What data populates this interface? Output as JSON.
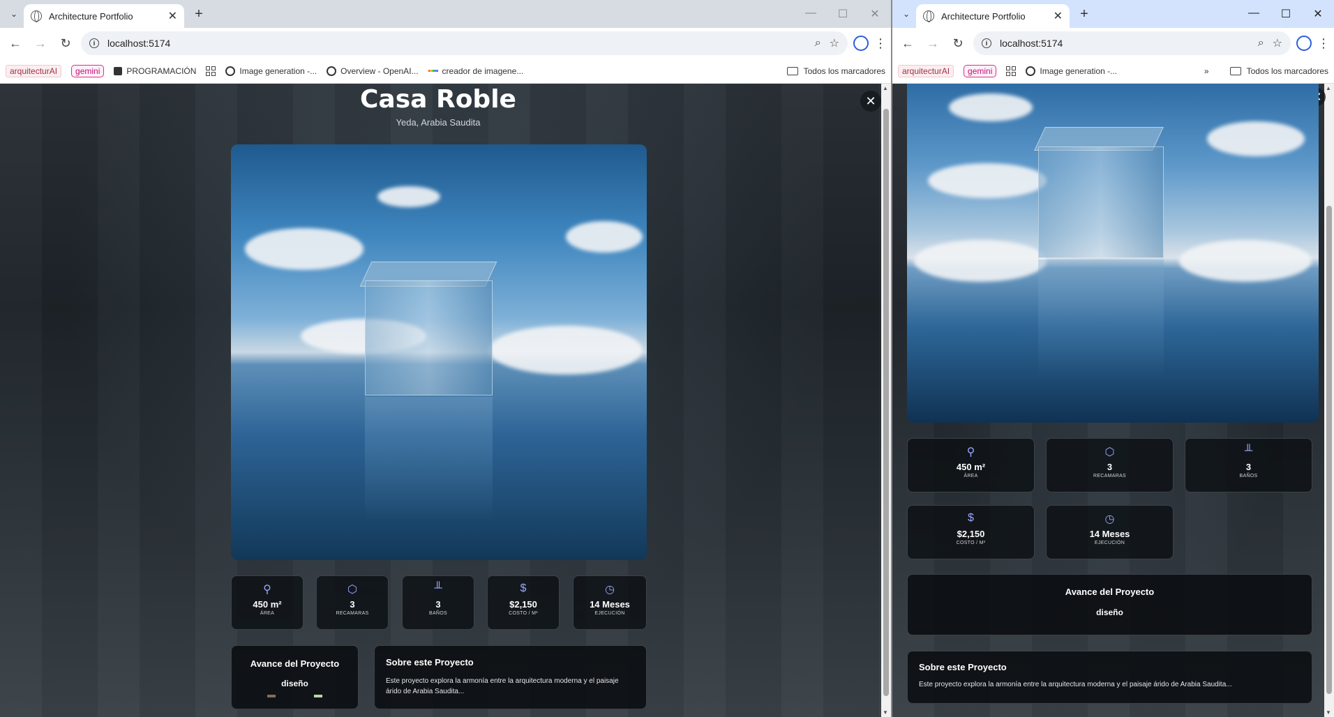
{
  "browser": {
    "tab_title": "Architecture Portfolio",
    "url": "localhost:5174",
    "bookmarks_left": [
      "arquitecturAI",
      "gemini",
      "PROGRAMACIÓN",
      "Image generation -...",
      "Overview - OpenAI...",
      "creador de imagene..."
    ],
    "bookmarks_right": [
      "arquitecturAI",
      "gemini",
      "Image generation -..."
    ],
    "all_bookmarks": "Todos los marcadores",
    "overflow_glyph": "»"
  },
  "project": {
    "name": "Casa Roble",
    "location": "Yeda, Arabia Saudita",
    "stats": [
      {
        "icon": "area-icon",
        "glyph": "⚲",
        "value": "450 m²",
        "label": "ÁREA"
      },
      {
        "icon": "bed-icon",
        "glyph": "⬡",
        "value": "3",
        "label": "RECAMARAS"
      },
      {
        "icon": "bath-icon",
        "glyph": "╨",
        "value": "3",
        "label": "BAÑOS"
      },
      {
        "icon": "cost-icon",
        "glyph": "$",
        "value": "$2,150",
        "label": "COSTO / M²"
      },
      {
        "icon": "clock-icon",
        "glyph": "◷",
        "value": "14 Meses",
        "label": "EJECUCIÓN"
      }
    ],
    "progress": {
      "title": "Avance del Proyecto",
      "phase": "diseño"
    },
    "about": {
      "title": "Sobre este Proyecto",
      "text": "Este proyecto explora la armonía entre la arquitectura moderna y el paisaje árido de Arabia Saudita..."
    }
  },
  "colors": {
    "accent_icon": "#9aa6ff",
    "dot_brown": "#8a6a50",
    "dot_green": "#b8d8a0"
  }
}
